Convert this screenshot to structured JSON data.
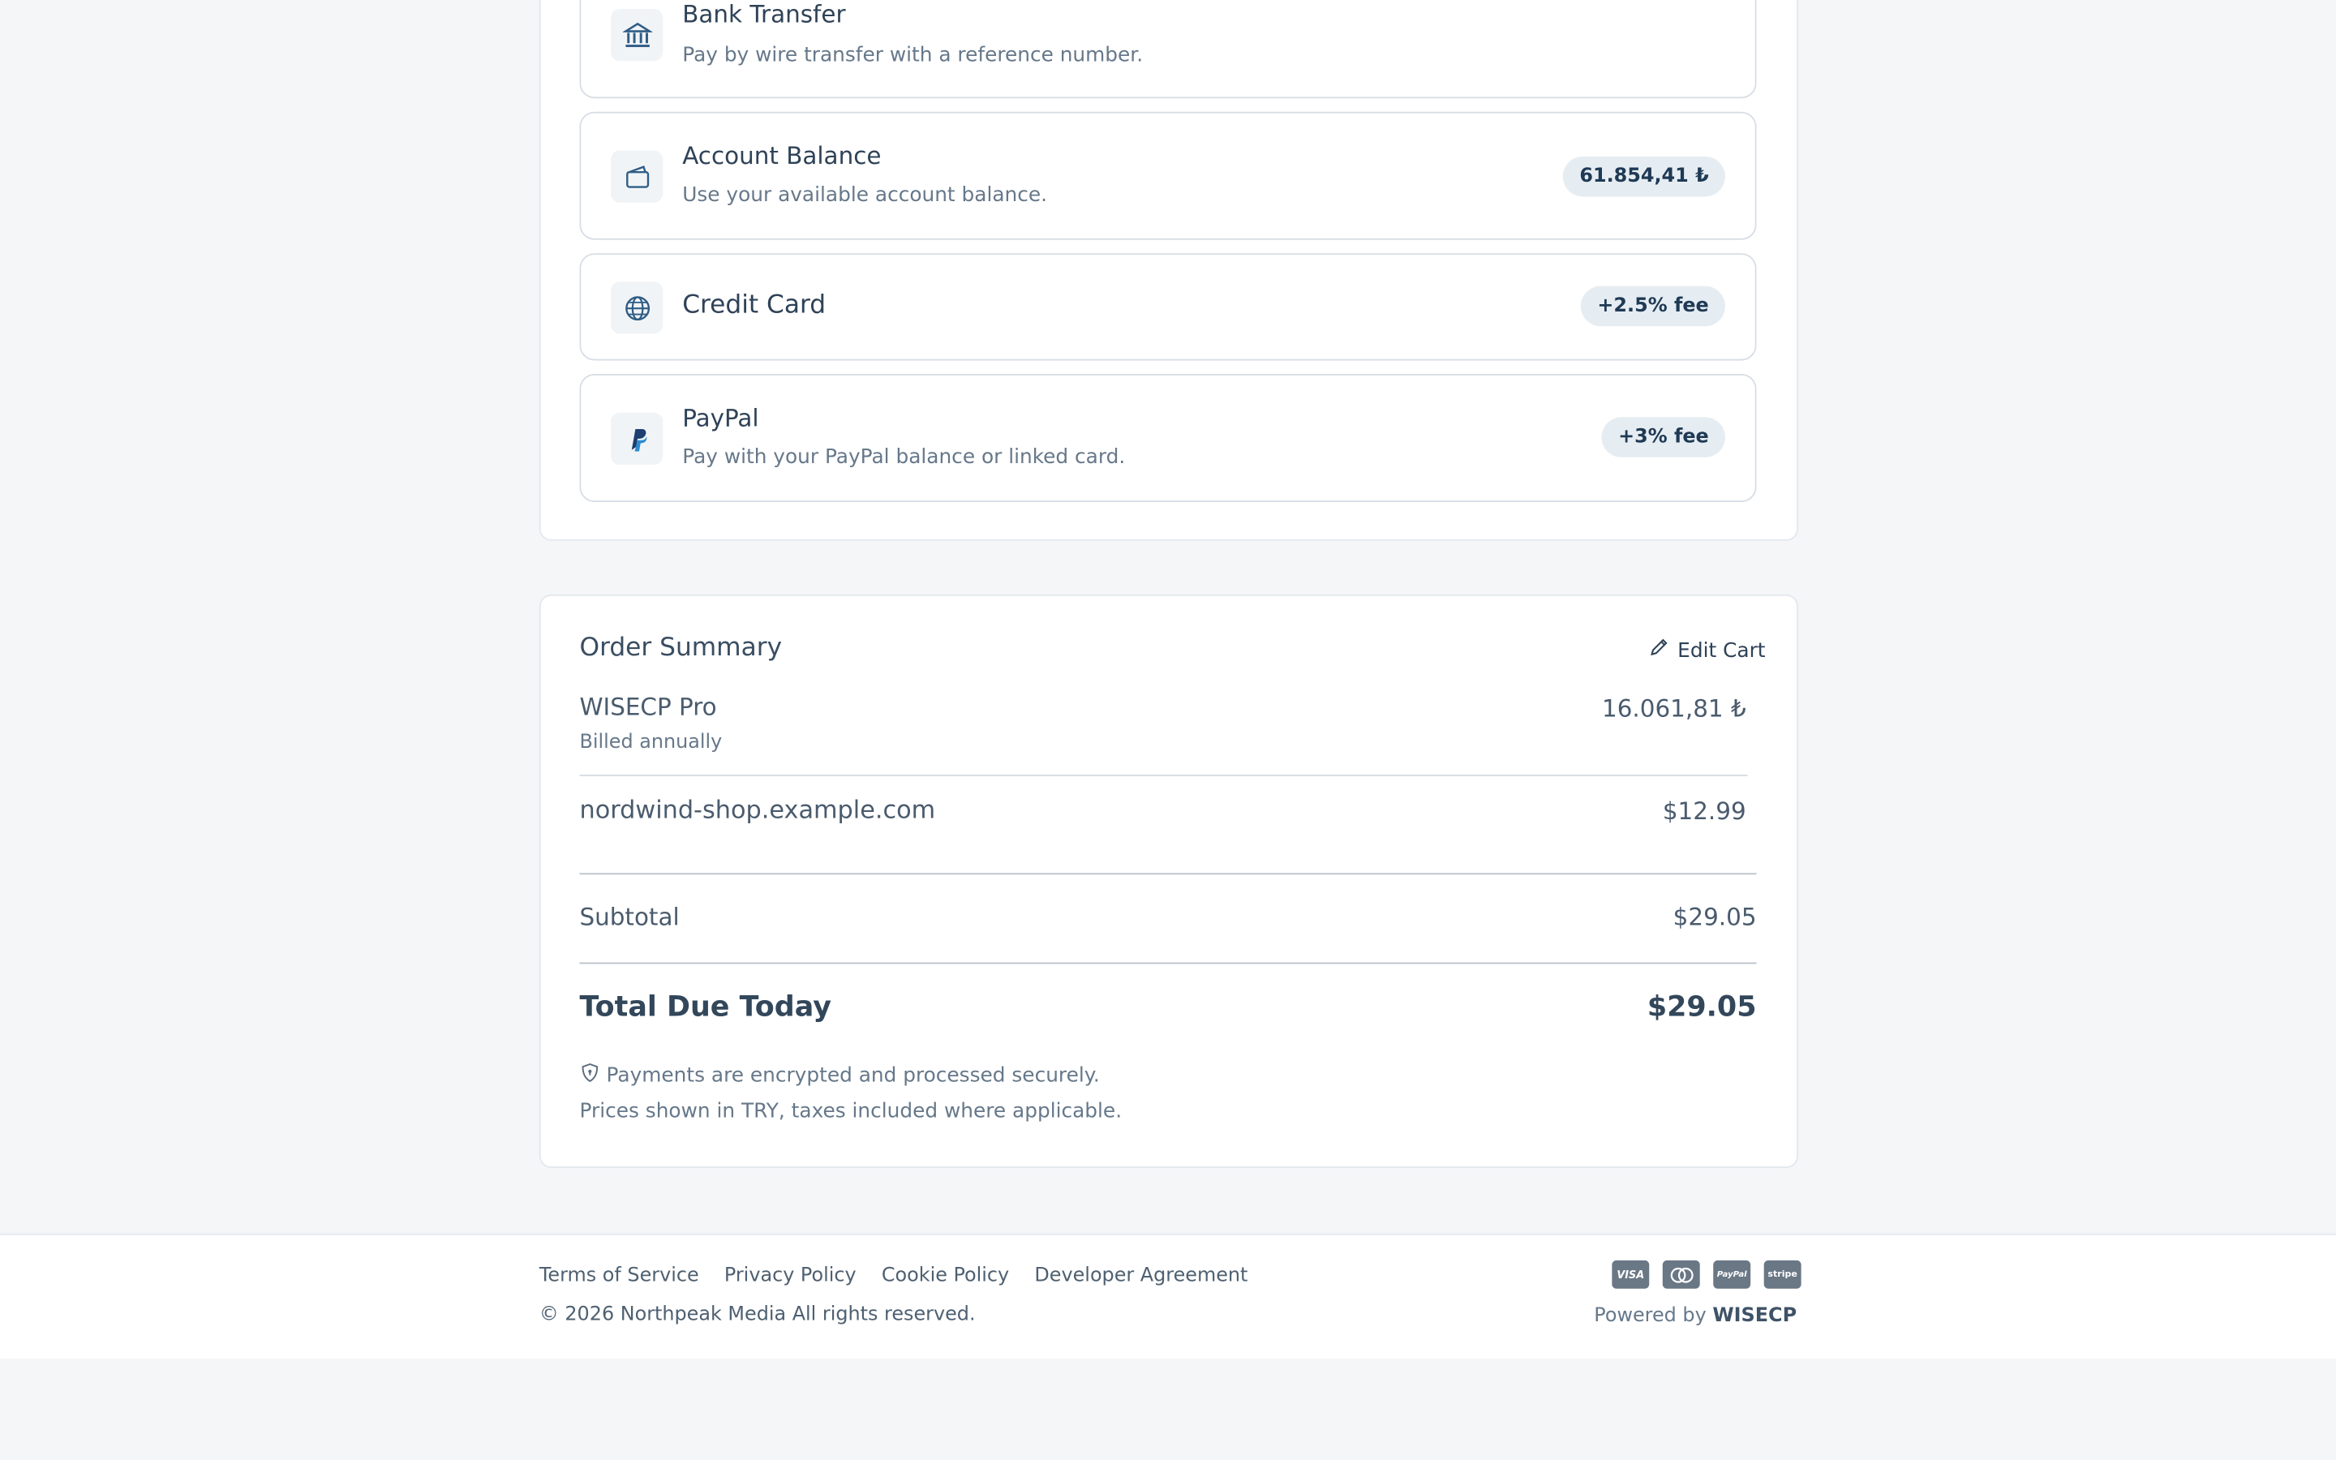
{
  "payment_methods": [
    {
      "title": "Bank Transfer",
      "description": "Pay by wire transfer with a reference number.",
      "badge": "",
      "icon": "bank-icon"
    },
    {
      "title": "Account Balance",
      "description": "Use your available account balance.",
      "badge": "61.854,41 ₺",
      "icon": "wallet-icon"
    },
    {
      "title": "Credit Card",
      "description": "",
      "badge": "+2.5% fee",
      "icon": "globe-icon"
    },
    {
      "title": "PayPal",
      "description": "Pay with your PayPal balance or linked card.",
      "badge": "+3% fee",
      "icon": "paypal-icon"
    }
  ],
  "order_summary": {
    "title": "Order Summary",
    "edit_cart_label": "Edit Cart",
    "items": [
      {
        "name": "WISECP Pro",
        "sub": "Billed annually",
        "price": "16.061,81 ₺"
      },
      {
        "name": "nordwind-shop.example.com",
        "sub": "",
        "price": "$12.99"
      }
    ],
    "subtotal_label": "Subtotal",
    "subtotal_value": "$29.05",
    "total_label": "Total Due Today",
    "total_value": "$29.05",
    "security_note": "Payments are encrypted and processed securely.",
    "currency_note": "Prices shown in TRY, taxes included where applicable."
  },
  "footer": {
    "links": [
      "Terms of Service",
      "Privacy Policy",
      "Cookie Policy",
      "Developer Agreement"
    ],
    "copyright": "© 2026 Northpeak Media All rights reserved.",
    "powered_prefix": "Powered by",
    "powered_brand": "WISECP",
    "card_logos": [
      "VISA",
      "",
      "PayPal",
      "stripe"
    ]
  },
  "colors": {
    "background": "#f4f6f8",
    "badge_bg": "#e6edf2",
    "accent_icon": "#2f5d86"
  }
}
